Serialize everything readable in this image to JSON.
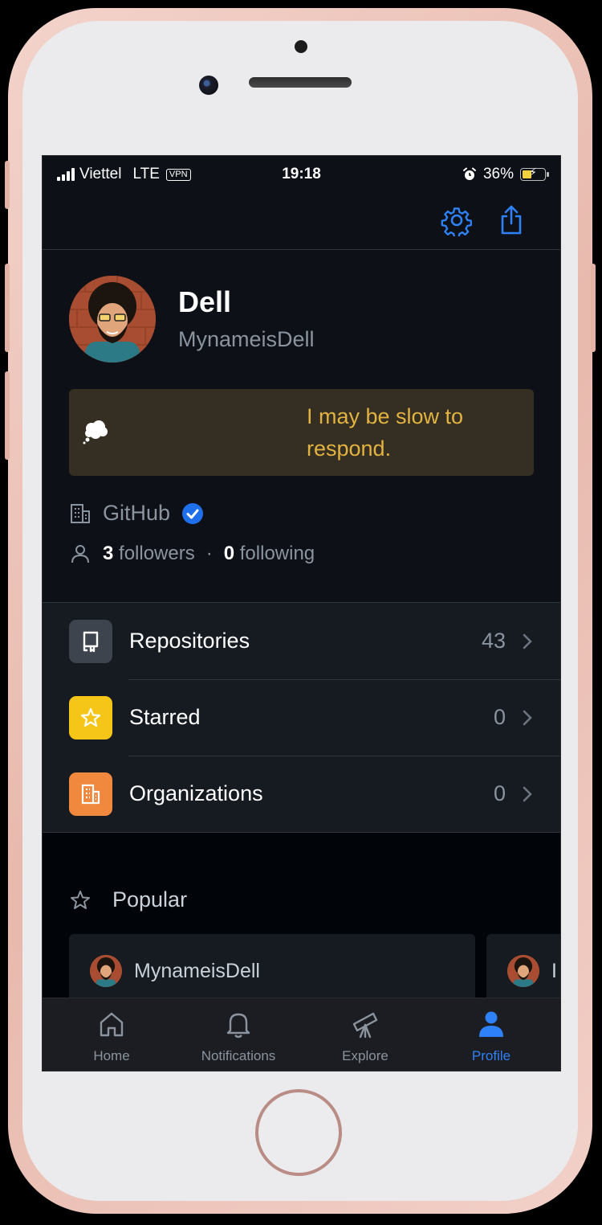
{
  "status_bar": {
    "carrier": "Viettel",
    "network": "LTE",
    "vpn": "VPN",
    "time": "19:18",
    "battery": "36%"
  },
  "header": {
    "settings_icon": "gear-icon",
    "share_icon": "share-icon"
  },
  "profile": {
    "name": "Dell",
    "login": "MynameisDell",
    "status_emoji": "thought-balloon",
    "status_text": "I may be slow to respond.",
    "company": "GitHub",
    "followers_count": "3",
    "followers_label": "followers",
    "separator": "·",
    "following_count": "0",
    "following_label": "following"
  },
  "menu": [
    {
      "label": "Repositories",
      "count": "43",
      "icon": "repo-icon",
      "color": "#3d444d"
    },
    {
      "label": "Starred",
      "count": "0",
      "icon": "star-icon",
      "color": "#f5c518"
    },
    {
      "label": "Organizations",
      "count": "0",
      "icon": "organization-icon",
      "color": "#f0883e"
    }
  ],
  "popular": {
    "title": "Popular",
    "cards": [
      {
        "owner": "MynameisDell"
      },
      {
        "owner": "I"
      }
    ]
  },
  "tabs": [
    {
      "label": "Home",
      "icon": "home-icon"
    },
    {
      "label": "Notifications",
      "icon": "bell-icon"
    },
    {
      "label": "Explore",
      "icon": "telescope-icon"
    },
    {
      "label": "Profile",
      "icon": "person-icon"
    }
  ],
  "colors": {
    "accent": "#2f81f7",
    "background": "#0d1117",
    "status_card": "#342f22",
    "status_text": "#e3b341"
  }
}
